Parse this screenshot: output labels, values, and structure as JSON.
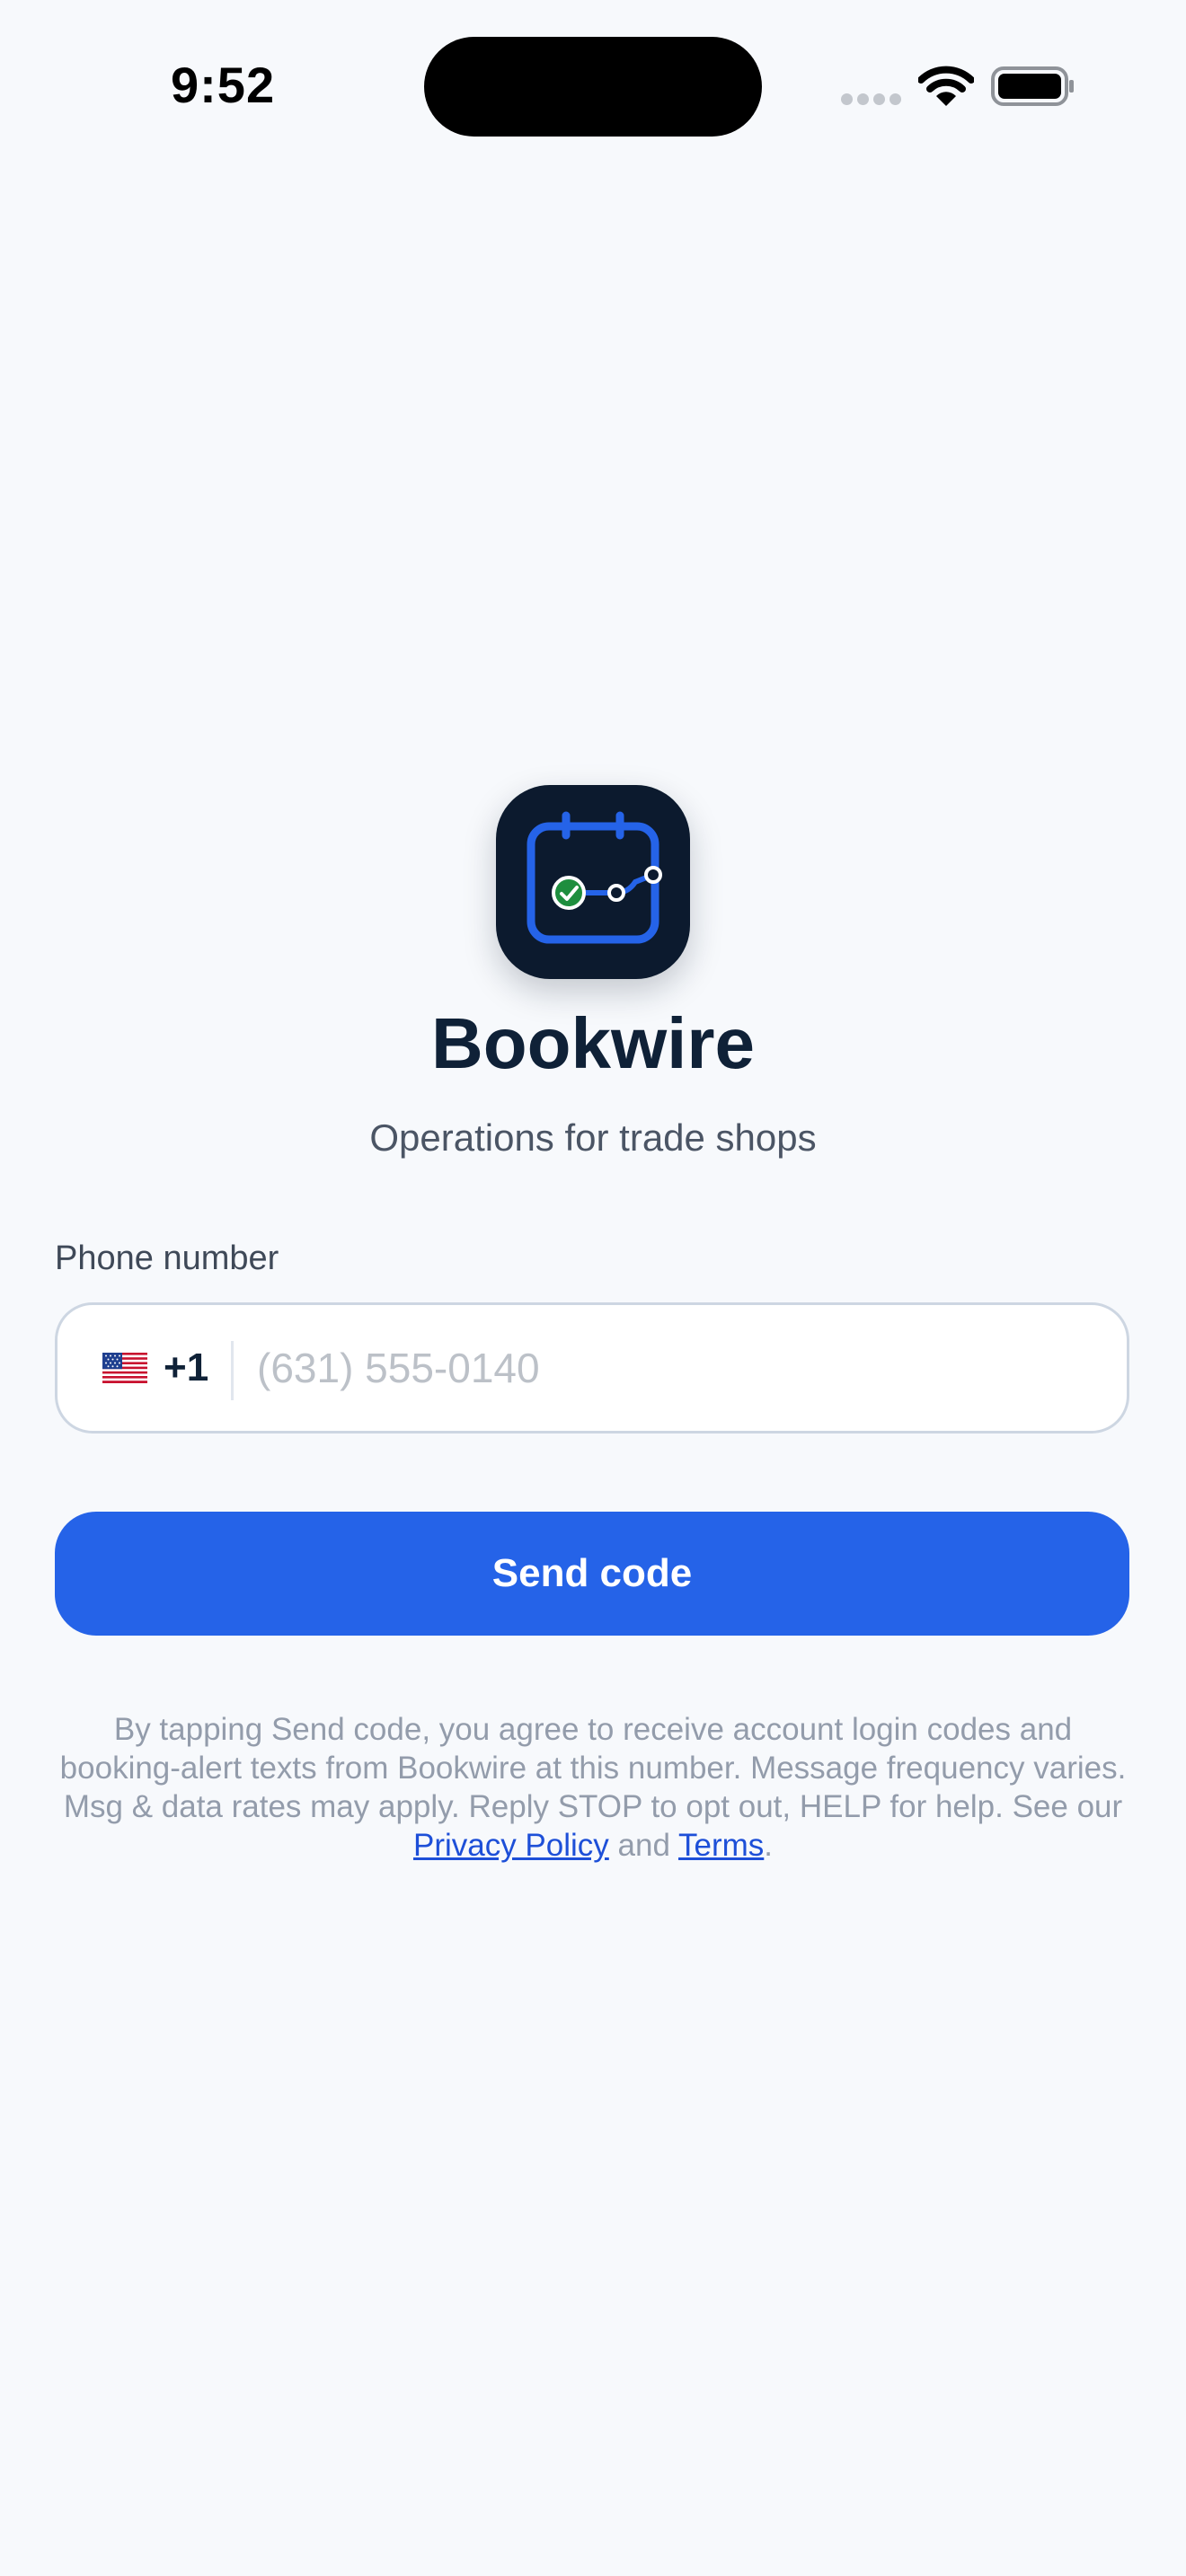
{
  "status_bar": {
    "time": "9:52"
  },
  "brand": {
    "icon": "calendar-chart-logo",
    "name": "Bookwire",
    "tagline": "Operations for trade shops"
  },
  "form": {
    "phone_label": "Phone number",
    "country_flag": "us-flag",
    "country_code": "+1",
    "phone_value": "",
    "phone_placeholder": "(631) 555-0140",
    "send_button_label": "Send code"
  },
  "consent": {
    "text": "By tapping Send code, you agree to receive account login codes and booking-alert texts from Bookwire at this number. Message frequency varies. Msg & data rates may apply. Reply STOP to opt out, HELP for help. See our ",
    "privacy_link": "Privacy Policy",
    "and": " and ",
    "terms_link": "Terms",
    "end": "."
  },
  "colors": {
    "background": "#f7f9fc",
    "accent": "#2563e8",
    "title": "#0f2137",
    "logo_background": "#0c1a2e",
    "success": "#1e8e3e",
    "link": "#1d4fd8"
  }
}
